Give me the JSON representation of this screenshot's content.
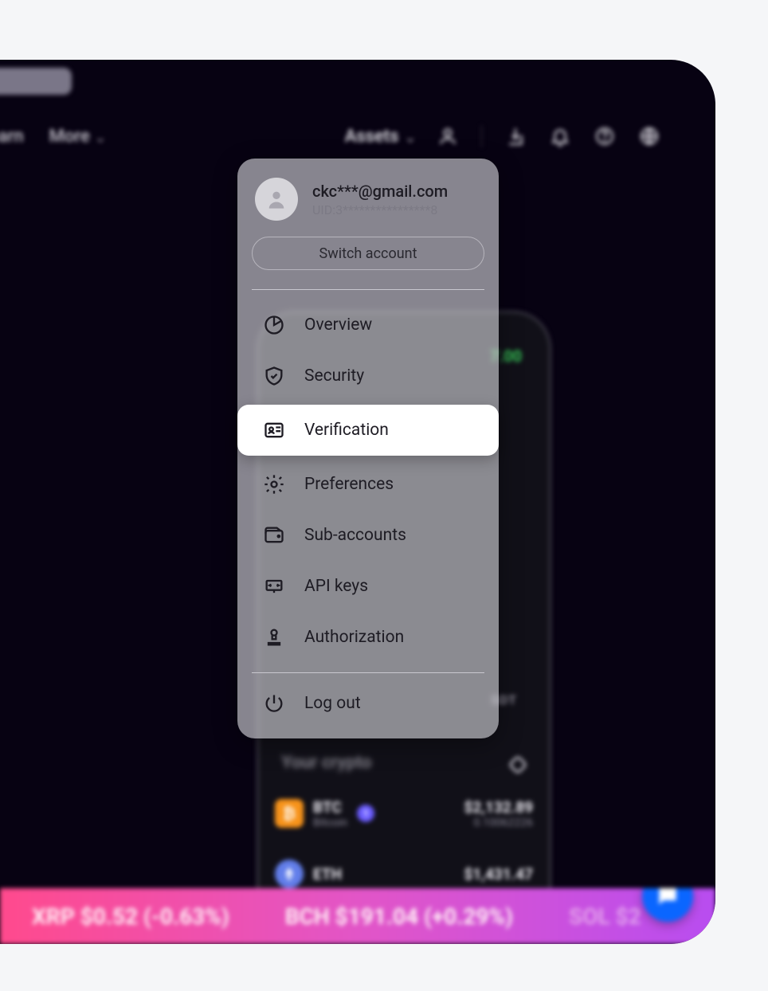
{
  "nav": {
    "learn": "earn",
    "more": "More",
    "assets": "Assets"
  },
  "user": {
    "email": "ckc***@gmail.com",
    "uid": "UID:3****************8",
    "switch": "Switch account"
  },
  "menu": {
    "overview": "Overview",
    "security": "Security",
    "verification": "Verification",
    "preferences": "Preferences",
    "subaccounts": "Sub-accounts",
    "apikeys": "API keys",
    "authorization": "Authorization",
    "logout": "Log out"
  },
  "phone": {
    "gain": "7.00",
    "label": "SDT",
    "section": "Your crypto",
    "btc": {
      "sym": "BTC",
      "name": "Bitcoin",
      "price": "$2,132.89",
      "qty": "0.10062226",
      "badge": "1"
    },
    "eth": {
      "sym": "ETH",
      "price": "$1,431.47"
    }
  },
  "ticker": {
    "xrp": "XRP $0.52 (-0.63%)",
    "bch": "BCH $191.04 (+0.29%)",
    "sol": "SOL $2"
  }
}
